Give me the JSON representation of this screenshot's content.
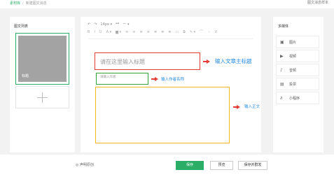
{
  "breadcrumb": {
    "home": "素材库",
    "current": "新建图文消息"
  },
  "header": {
    "preview_link": "图文消息样本"
  },
  "left_panel": {
    "title": "图文列表",
    "thumb_label": "标题"
  },
  "toolbar": {
    "row1": [
      "↶",
      "↷",
      "14px ▾",
      "❝❞",
      "一 ▾"
    ],
    "row2": [
      "B",
      "I",
      "U",
      "A ▾",
      "▆ ▾",
      "≡",
      "≡",
      "≡",
      "≡",
      "≣",
      "≣",
      "≣",
      "▭",
      "⧉",
      "✎ ▾",
      "⌒",
      "♢",
      "Ⅴ"
    ]
  },
  "editor": {
    "title_placeholder": "请在这里输入标题",
    "author_placeholder": "请输入作者",
    "annotations": {
      "title": "输入文章主标题",
      "author": "输入作者名称",
      "body": "输入正文"
    }
  },
  "right_panel": {
    "title": "多媒体",
    "items": [
      {
        "label": "图片",
        "icon": "image-icon"
      },
      {
        "label": "视频",
        "icon": "video-icon"
      },
      {
        "label": "音频",
        "icon": "audio-icon"
      },
      {
        "label": "投票",
        "icon": "vote-icon"
      },
      {
        "label": "小程序",
        "icon": "mini-program-icon"
      }
    ]
  },
  "bottom_bar": {
    "original": "◎ 声明原创",
    "save": "保存",
    "preview": "预览",
    "publish": "保存并群发"
  },
  "colors": {
    "accent": "#2aae67",
    "title_box": "#e43c32",
    "author_box": "#32a33a",
    "body_box": "#f2b81c",
    "annotation": "#1e88e5"
  }
}
